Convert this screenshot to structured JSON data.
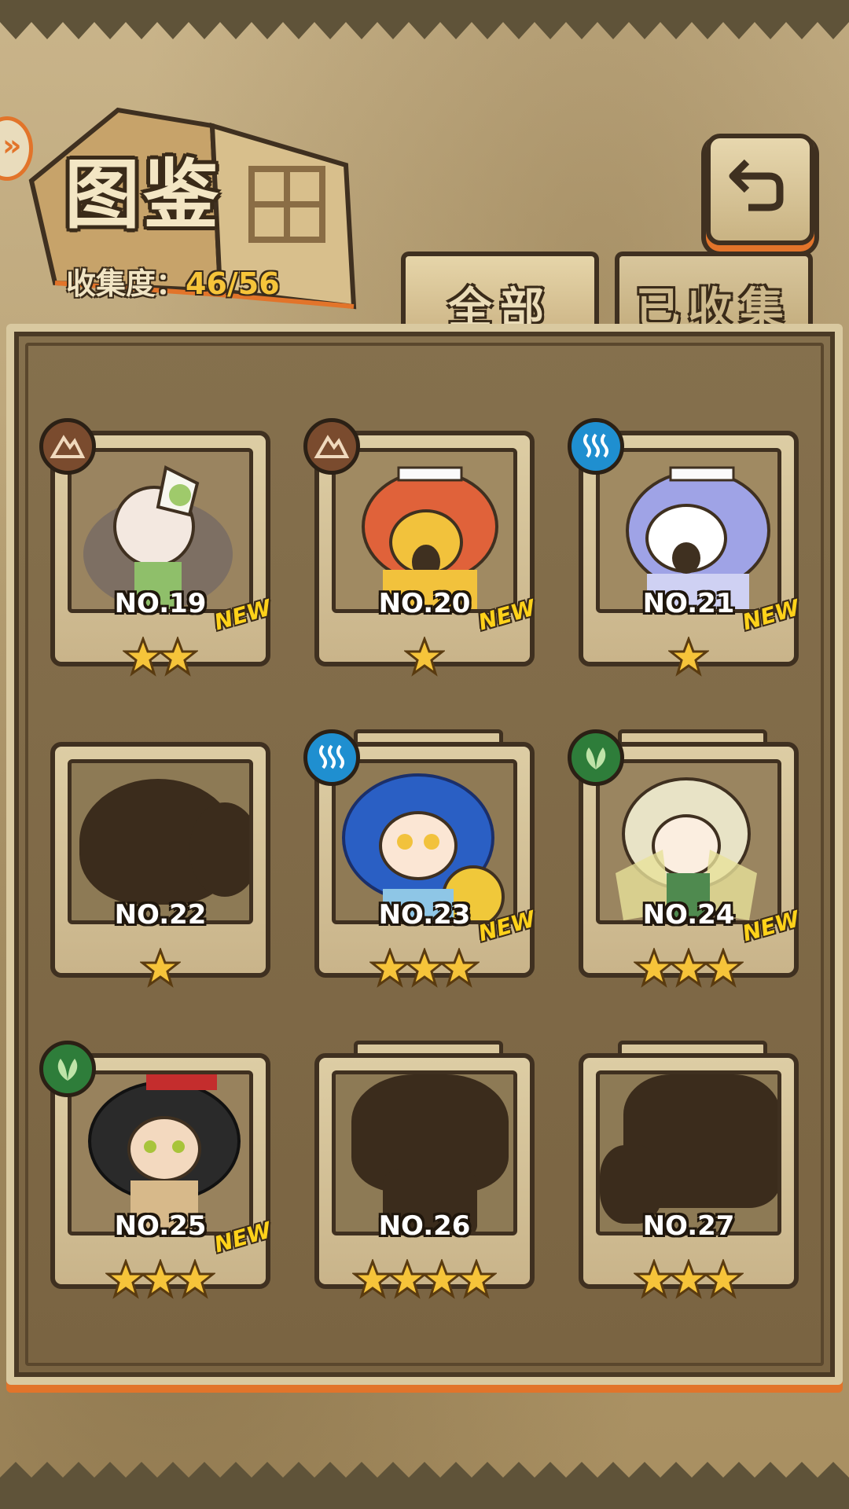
{
  "header": {
    "title": "图鉴",
    "collect_label": "收集度：",
    "collect_value": "46/56"
  },
  "tabs": [
    {
      "label": "全部",
      "active": true
    },
    {
      "label": "已收集",
      "active": false
    }
  ],
  "colors": {
    "accent_orange": "#e2742a",
    "parchment": "#c9b48a",
    "frame_dark": "#3f3020",
    "star_yellow": "#f6c43a",
    "new_yellow": "#ffd21a"
  },
  "cards": [
    {
      "no": "NO.19",
      "stars": 2,
      "element": "earth-icon",
      "new": true,
      "discovered": true,
      "portrait_color": "#c89cbf"
    },
    {
      "no": "NO.20",
      "stars": 1,
      "element": "earth-icon",
      "new": true,
      "discovered": true,
      "portrait_color": "#e0623a"
    },
    {
      "no": "NO.21",
      "stars": 1,
      "element": "water-icon",
      "new": true,
      "discovered": true,
      "portrait_color": "#9fa3e6"
    },
    {
      "no": "NO.22",
      "stars": 1,
      "element": "",
      "new": false,
      "discovered": false,
      "portrait_color": "#3b2c1c"
    },
    {
      "no": "NO.23",
      "stars": 3,
      "element": "water-icon",
      "new": true,
      "discovered": true,
      "portrait_color": "#2a5fc4"
    },
    {
      "no": "NO.24",
      "stars": 3,
      "element": "wood-icon",
      "new": true,
      "discovered": true,
      "portrait_color": "#d9d6b8"
    },
    {
      "no": "NO.25",
      "stars": 3,
      "element": "wood-icon",
      "new": true,
      "discovered": true,
      "portrait_color": "#2a2a2a"
    },
    {
      "no": "NO.26",
      "stars": 4,
      "element": "",
      "new": false,
      "discovered": false,
      "portrait_color": "#3b2c1c"
    },
    {
      "no": "NO.27",
      "stars": 3,
      "element": "",
      "new": false,
      "discovered": false,
      "portrait_color": "#3b2c1c"
    }
  ],
  "new_label": "NEW"
}
